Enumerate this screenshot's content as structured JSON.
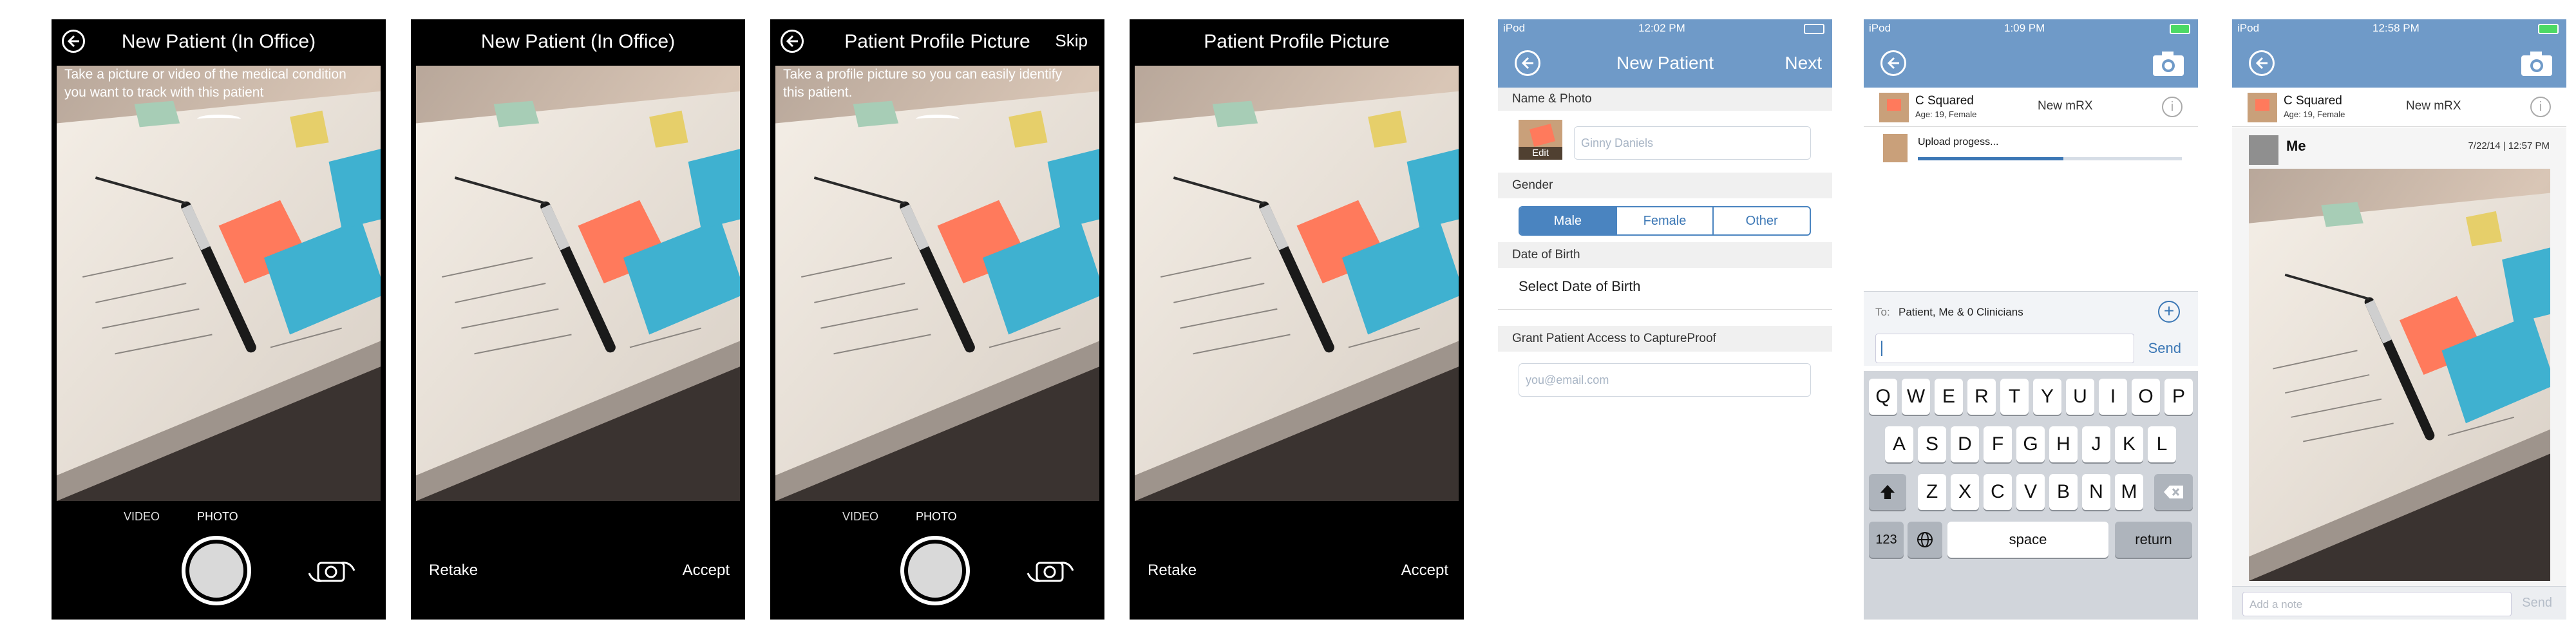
{
  "screens": {
    "s1": {
      "title": "New Patient (In Office)",
      "instruction": "Take a picture or video of the medical condition you want to track with this patient",
      "mode_video": "VIDEO",
      "mode_photo": "PHOTO"
    },
    "s2": {
      "title": "New Patient (In Office)",
      "retake": "Retake",
      "accept": "Accept"
    },
    "s3": {
      "title": "Patient Profile Picture",
      "skip": "Skip",
      "instruction": "Take a profile picture so you can easily identify this patient.",
      "mode_video": "VIDEO",
      "mode_photo": "PHOTO"
    },
    "s4": {
      "title": "Patient Profile Picture",
      "retake": "Retake",
      "accept": "Accept"
    },
    "s5": {
      "carrier": "iPod",
      "time": "12:02 PM",
      "title": "New Patient",
      "next": "Next",
      "section_name_photo": "Name & Photo",
      "edit": "Edit",
      "name_placeholder": "Ginny Daniels",
      "section_gender": "Gender",
      "gender_options": [
        "Male",
        "Female",
        "Other"
      ],
      "gender_selected": "Male",
      "section_dob": "Date of Birth",
      "dob_placeholder": "Select Date of Birth",
      "section_access": "Grant Patient Access to CaptureProof",
      "email_placeholder": "you@email.com"
    },
    "s6": {
      "carrier": "iPod",
      "time": "1:09 PM",
      "patient_name": "C Squared",
      "patient_info": "Age: 19, Female",
      "new_rx": "New mRX",
      "upload_text": "Upload progess...",
      "upload_progress": 0.55,
      "to_label": "To:",
      "to_value": "Patient, Me & 0 Clinicians",
      "send": "Send",
      "kb_row1": [
        "Q",
        "W",
        "E",
        "R",
        "T",
        "Y",
        "U",
        "I",
        "O",
        "P"
      ],
      "kb_row2": [
        "A",
        "S",
        "D",
        "F",
        "G",
        "H",
        "J",
        "K",
        "L"
      ],
      "kb_row3": [
        "Z",
        "X",
        "C",
        "V",
        "B",
        "N",
        "M"
      ],
      "kb_123": "123",
      "kb_space": "space",
      "kb_return": "return"
    },
    "s7": {
      "carrier": "iPod",
      "time": "12:58 PM",
      "patient_name": "C Squared",
      "patient_info": "Age: 19, Female",
      "new_rx": "New mRX",
      "author": "Me",
      "timestamp": "7/22/14 | 12:57 PM",
      "note_placeholder": "Add a note",
      "send": "Send"
    }
  }
}
